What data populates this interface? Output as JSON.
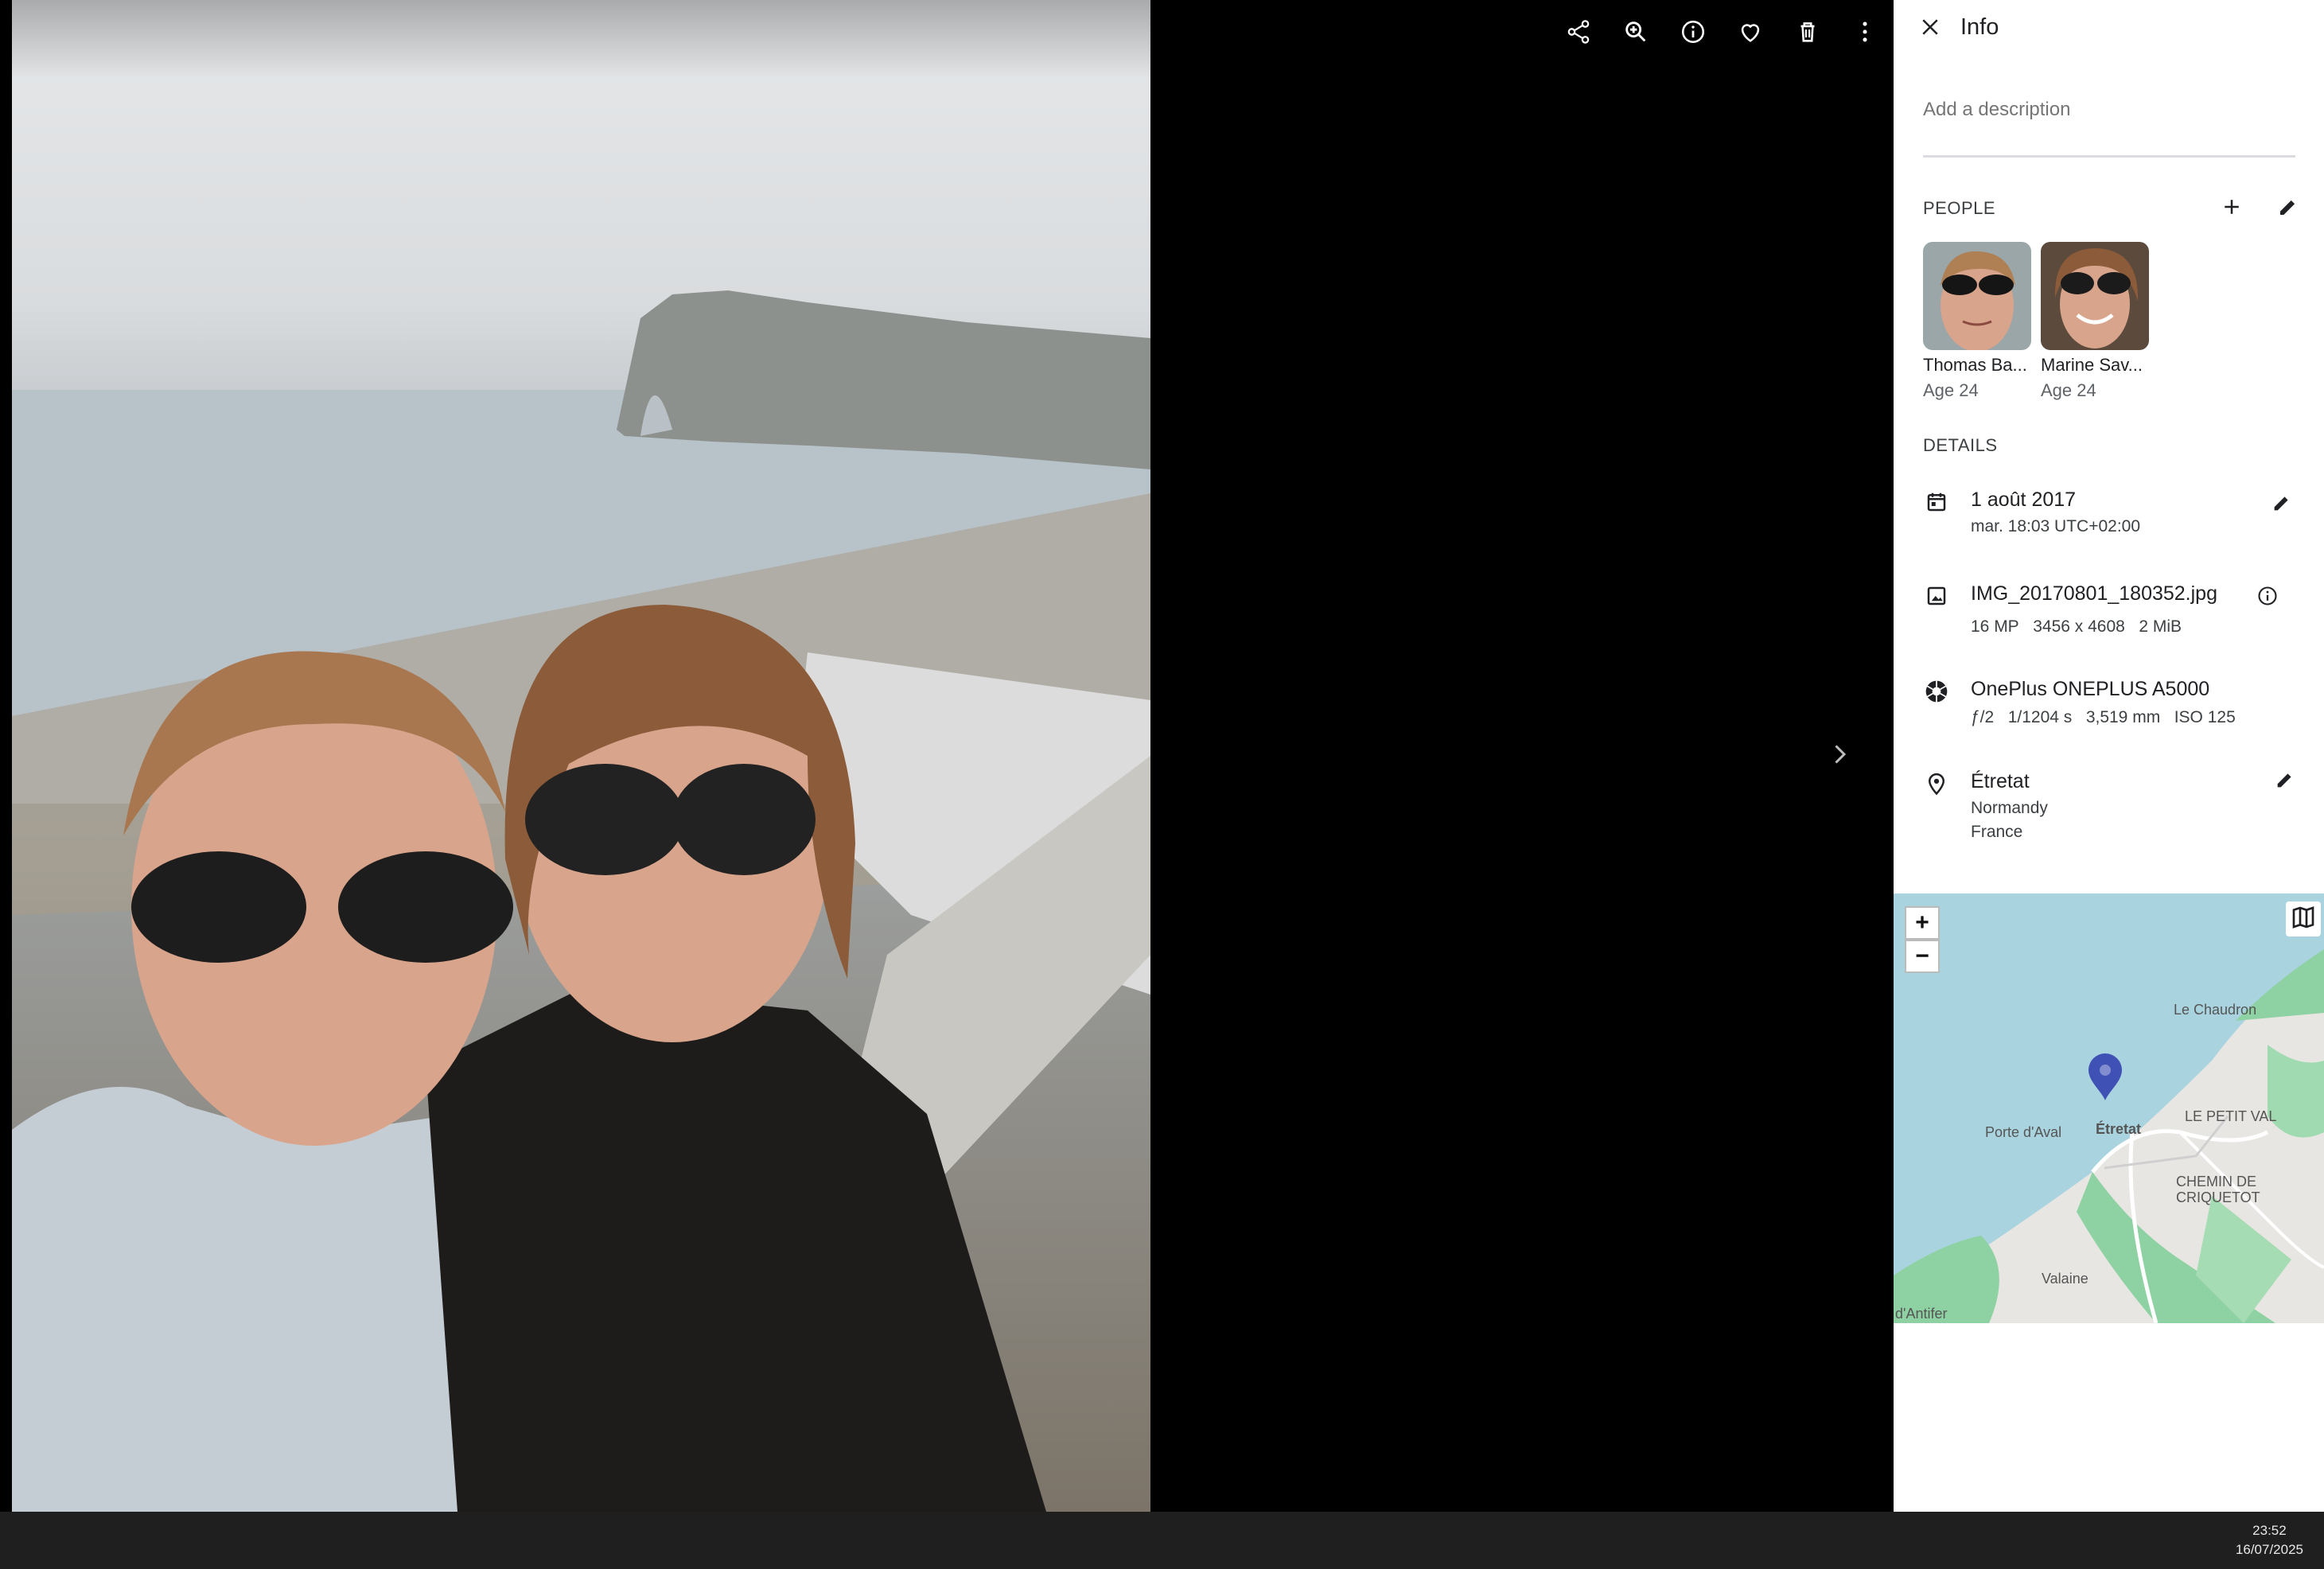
{
  "toolbar": {
    "icons": [
      "share-icon",
      "zoom-in-icon",
      "info-icon",
      "favorite-icon",
      "delete-icon",
      "more-vert-icon"
    ]
  },
  "panel": {
    "title": "Info",
    "description_placeholder": "Add a description",
    "people_heading": "PEOPLE",
    "people": [
      {
        "name": "Thomas Ba...",
        "age": "Age 24"
      },
      {
        "name": "Marine Sav...",
        "age": "Age 24"
      }
    ],
    "details_heading": "DETAILS",
    "date": {
      "main": "1 août 2017",
      "sub": "mar. 18:03 UTC+02:00"
    },
    "file": {
      "name": "IMG_20170801_180352.jpg",
      "megapixels": "16 MP",
      "resolution": "3456 x 4608",
      "size": "2 MiB"
    },
    "camera": {
      "model": "OnePlus ONEPLUS A5000",
      "aperture": "ƒ/2",
      "shutter": "1/1204 s",
      "focal": "3,519 mm",
      "iso": "ISO 125"
    },
    "location": {
      "city": "Étretat",
      "region": "Normandy",
      "country": "France"
    }
  },
  "map": {
    "zoom_in": "+",
    "zoom_out": "−",
    "labels": [
      "Le Chaudron",
      "LE PETIT VAL",
      "Porte d'Aval",
      "Étretat",
      "CHEMIN DE",
      "CRIQUETOT",
      "Valaine",
      "d'Antifer"
    ]
  },
  "taskbar": {
    "time": "23:52",
    "date": "16/07/2025"
  },
  "colors": {
    "panel_bg": "#ffffff",
    "sea": "#a9d3df",
    "land": "#e8e6e2",
    "pin": "#3f51b5",
    "taskbar": "#1f1f1f"
  }
}
